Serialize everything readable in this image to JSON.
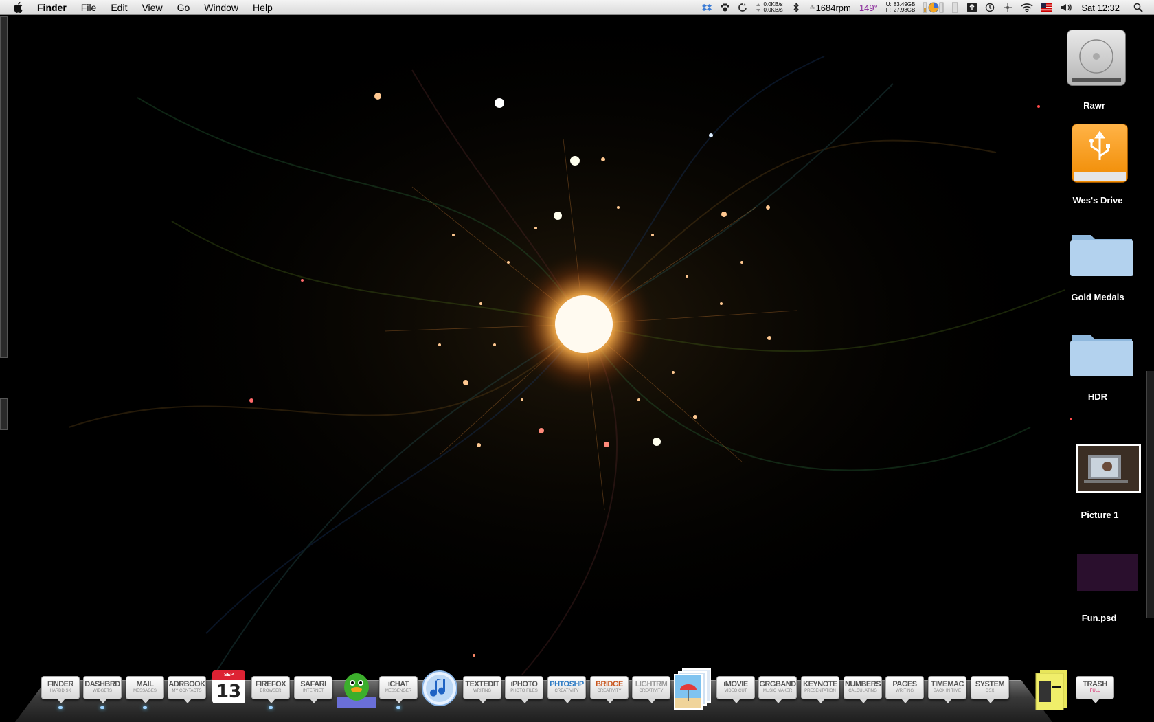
{
  "menubar": {
    "app_name": "Finder",
    "menus": [
      "File",
      "Edit",
      "View",
      "Go",
      "Window",
      "Help"
    ],
    "net_up": "0.0KB/s",
    "net_down": "0.0KB/s",
    "fan": "1684rpm",
    "temp": "149°",
    "disk_used_label": "U:",
    "disk_free_label": "F:",
    "disk_used": "83.49GB",
    "disk_free": "27.98GB",
    "clock": "Sat 12:32"
  },
  "desktop_icons": [
    {
      "label": "Rawr",
      "kind": "hard-drive"
    },
    {
      "label": "Wes's Drive",
      "kind": "usb-drive"
    },
    {
      "label": "Gold Medals",
      "kind": "folder"
    },
    {
      "label": "HDR",
      "kind": "folder"
    },
    {
      "label": "Picture 1",
      "kind": "image-file"
    },
    {
      "label": "Fun.psd",
      "kind": "psd-file"
    }
  ],
  "dock": {
    "items": [
      {
        "name": "FINDER",
        "sub": "HARDDISK",
        "running": true
      },
      {
        "name": "DASHBRD",
        "sub": "WIDGETS",
        "running": true
      },
      {
        "name": "MAIL",
        "sub": "MESSAGES",
        "running": true
      },
      {
        "name": "ADRBOOK",
        "sub": "MY CONTACTS",
        "running": false
      },
      {
        "name": "FIREFOX",
        "sub": "BROWSER",
        "running": true
      },
      {
        "name": "SAFARI",
        "sub": "INTERNET",
        "running": false
      },
      {
        "name": "iCHAT",
        "sub": "MESSENGER",
        "running": true
      },
      {
        "name": "TEXTEDIT",
        "sub": "WRITING",
        "running": false
      },
      {
        "name": "iPHOTO",
        "sub": "PHOTO FILES",
        "running": false
      },
      {
        "name": "PHTOSHP",
        "sub": "CREATIVITY",
        "running": false,
        "color": "#2d7bc4"
      },
      {
        "name": "BRIDGE",
        "sub": "CREATIVITY",
        "running": false,
        "color": "#c8551d"
      },
      {
        "name": "LIGHTRM",
        "sub": "CREATIVITY",
        "running": false,
        "color": "#9a9a9a"
      },
      {
        "name": "iMOVIE",
        "sub": "VIDEO CUT",
        "running": false
      },
      {
        "name": "GRGBAND",
        "sub": "MUSIC MAKER",
        "running": false
      },
      {
        "name": "KEYNOTE",
        "sub": "PRESENTATION",
        "running": false
      },
      {
        "name": "NUMBERS",
        "sub": "CALCULATING",
        "running": false
      },
      {
        "name": "PAGES",
        "sub": "WRITING",
        "running": false
      },
      {
        "name": "TIMEMAC",
        "sub": "BACK IN TIME",
        "running": false
      },
      {
        "name": "SYSTEM",
        "sub": "OSX",
        "running": false
      },
      {
        "name": "TRASH",
        "sub": "FULL",
        "running": false
      }
    ],
    "calendar": {
      "month": "SEP",
      "day": "13"
    }
  },
  "colors": {
    "accent": "#9fd3ff",
    "temp": "#8b2a9c",
    "sun": "#ffd27a"
  }
}
